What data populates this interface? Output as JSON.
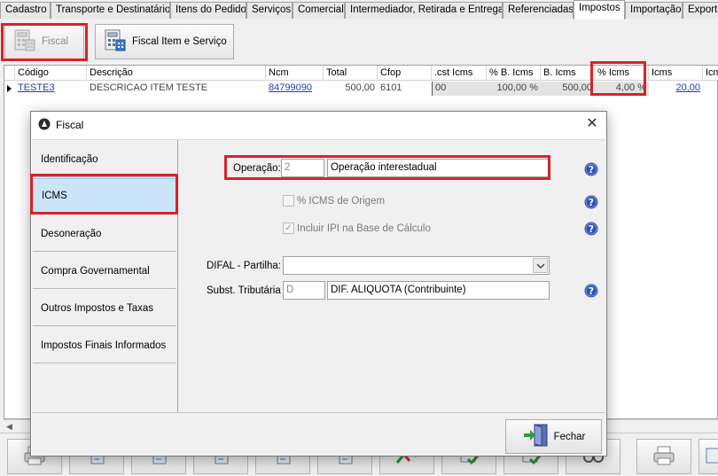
{
  "tabs": [
    {
      "label": "Cadastro",
      "active": false
    },
    {
      "label": "Transporte e Destinatário",
      "active": false
    },
    {
      "label": "Itens do Pedido",
      "active": false
    },
    {
      "label": "Serviços",
      "active": false
    },
    {
      "label": "Comercial",
      "active": false
    },
    {
      "label": "Intermediador, Retirada e Entrega",
      "active": false
    },
    {
      "label": "Referenciadas",
      "active": false
    },
    {
      "label": "Impostos",
      "active": true
    },
    {
      "label": "Importação",
      "active": false
    },
    {
      "label": "Exporta",
      "active": false
    }
  ],
  "toolbar": {
    "fiscal_label": "Fiscal",
    "fiscal_item_servico_label": "Fiscal Item e Serviço"
  },
  "grid": {
    "columns": [
      "Código",
      "Descrição",
      "Ncm",
      "Total",
      "Cfop",
      ".cst Icms",
      "% B. Icms",
      "B. Icms",
      "% Icms",
      "Icms",
      "Icm"
    ],
    "rows": [
      {
        "codigo": "TESTE3",
        "descricao": "DESCRICAO ITEM TESTE",
        "ncm": "84799090",
        "total": "500,00",
        "cfop": "6101",
        "cst_icms": "00",
        "pct_b_icms": "100,00 %",
        "b_icms": "500,00",
        "pct_icms": "4,00 %",
        "icms": "20,00"
      }
    ]
  },
  "dialog": {
    "title": "Fiscal",
    "sidebar": [
      {
        "label": "Identificação",
        "selected": false
      },
      {
        "label": "ICMS",
        "selected": true
      },
      {
        "label": "Desoneração",
        "selected": false
      },
      {
        "label": "Compra Governamental",
        "selected": false
      },
      {
        "label": "Outros Impostos e Taxas",
        "selected": false
      },
      {
        "label": "Impostos Finais Informados",
        "selected": false
      }
    ],
    "operacao": {
      "label": "Operação:",
      "code": "2",
      "description": "Operação interestadual"
    },
    "icms_origem": {
      "label": "% ICMS de Origem",
      "checked": false
    },
    "incluir_ipi": {
      "label": "Incluir IPI na Base de Cálculo",
      "checked": true
    },
    "difal": {
      "label": "DIFAL - Partilha:",
      "value": ""
    },
    "subst": {
      "label": "Subst. Tributária",
      "code": "D",
      "description": "DIF. ALIQUOTA (Contribuinte)"
    },
    "close_button_label": "Fechar"
  },
  "colors": {
    "highlight_box": "#d9222a",
    "selected_item": "#cce4f7",
    "link": "#1f3fb5",
    "help_icon": "#2d4fb8"
  }
}
